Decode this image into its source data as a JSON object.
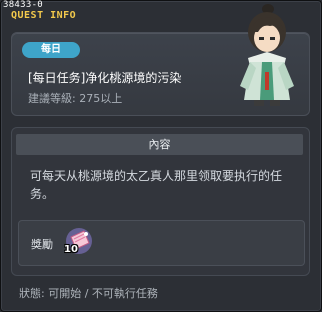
{
  "header": {
    "id": "38433-0",
    "title": "QUEST INFO"
  },
  "quest": {
    "badge": "每日",
    "name": "[每日任务]净化桃源境的污染",
    "level": "建議等級: 275以上"
  },
  "content": {
    "heading": "內容",
    "description": "可每天从桃源境的太乙真人那里领取要执行的任务。"
  },
  "reward": {
    "label": "獎勵",
    "item_icon": "pink-scroll-icon",
    "item_count": "10"
  },
  "status": "狀態: 可開始 / 不可執行任務",
  "colors": {
    "title": "#f2c94c",
    "badge": "#3ea4c9"
  }
}
